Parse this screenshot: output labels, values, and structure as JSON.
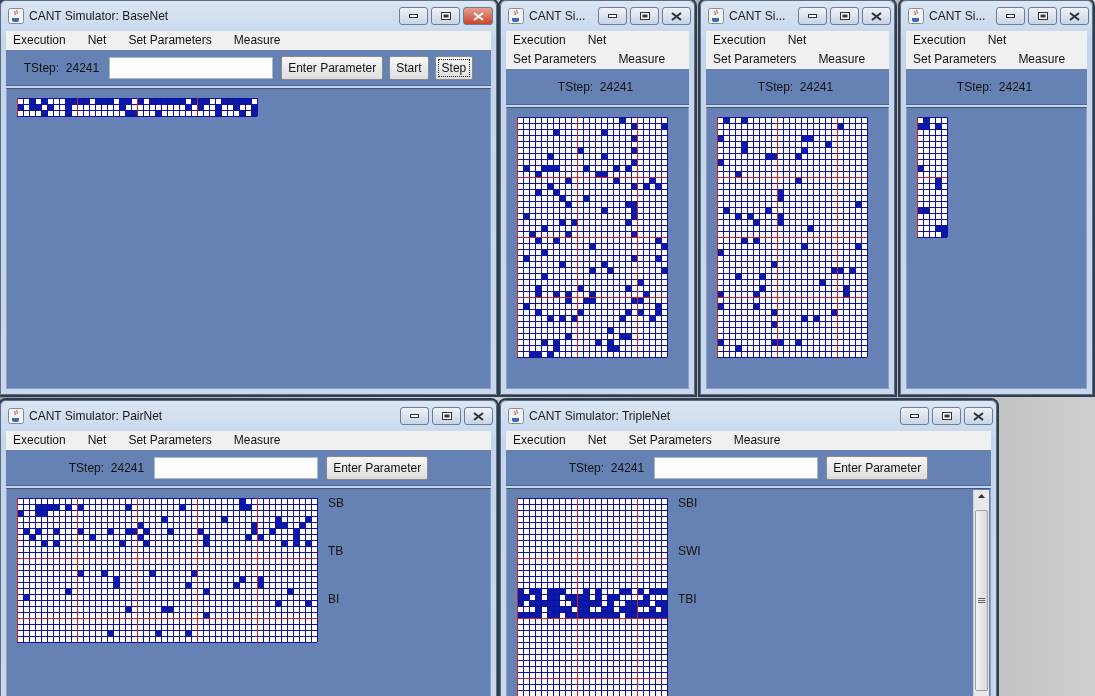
{
  "windows": [
    {
      "title": "CANT Simulator: BaseNet",
      "kind": "wide",
      "active": true,
      "scrollable": false,
      "menu": [
        "Execution",
        "Net",
        "Set Parameters",
        "Measure"
      ],
      "tstep": "TStep:  24241",
      "buttons": [
        {
          "label": "Enter Parameter",
          "focused": false
        },
        {
          "label": "Start",
          "focused": false
        },
        {
          "label": "Step",
          "focused": true
        }
      ]
    },
    {
      "title": "CANT Si...",
      "kind": "narrow",
      "active": false,
      "scrollable": false,
      "menu": [
        "Execution",
        "Net",
        "Set Parameters",
        "Measure"
      ],
      "tstep": "TStep:  24241"
    },
    {
      "title": "CANT Si...",
      "kind": "narrow",
      "active": false,
      "scrollable": false,
      "menu": [
        "Execution",
        "Net",
        "Set Parameters",
        "Measure"
      ],
      "tstep": "TStep:  24241"
    },
    {
      "title": "CANT Si...",
      "kind": "narrow",
      "active": false,
      "scrollable": false,
      "menu": [
        "Execution",
        "Net",
        "Set Parameters",
        "Measure"
      ],
      "tstep": "TStep:  24241"
    },
    {
      "title": "CANT Simulator: PairNet",
      "kind": "wide",
      "active": false,
      "scrollable": false,
      "menu": [
        "Execution",
        "Net",
        "Set Parameters",
        "Measure"
      ],
      "tstep": "TStep:  24241",
      "buttons": [
        {
          "label": "Enter Parameter",
          "focused": false
        }
      ],
      "labels": [
        "SB",
        "TB",
        "BI"
      ]
    },
    {
      "title": "CANT Simulator: TripleNet",
      "kind": "wide",
      "active": false,
      "scrollable": true,
      "menu": [
        "Execution",
        "Net",
        "Set Parameters",
        "Measure"
      ],
      "tstep": "TStep:  24241",
      "buttons": [
        {
          "label": "Enter Parameter",
          "focused": false
        }
      ],
      "labels": [
        "SBI",
        "SWI",
        "TBI"
      ]
    }
  ]
}
